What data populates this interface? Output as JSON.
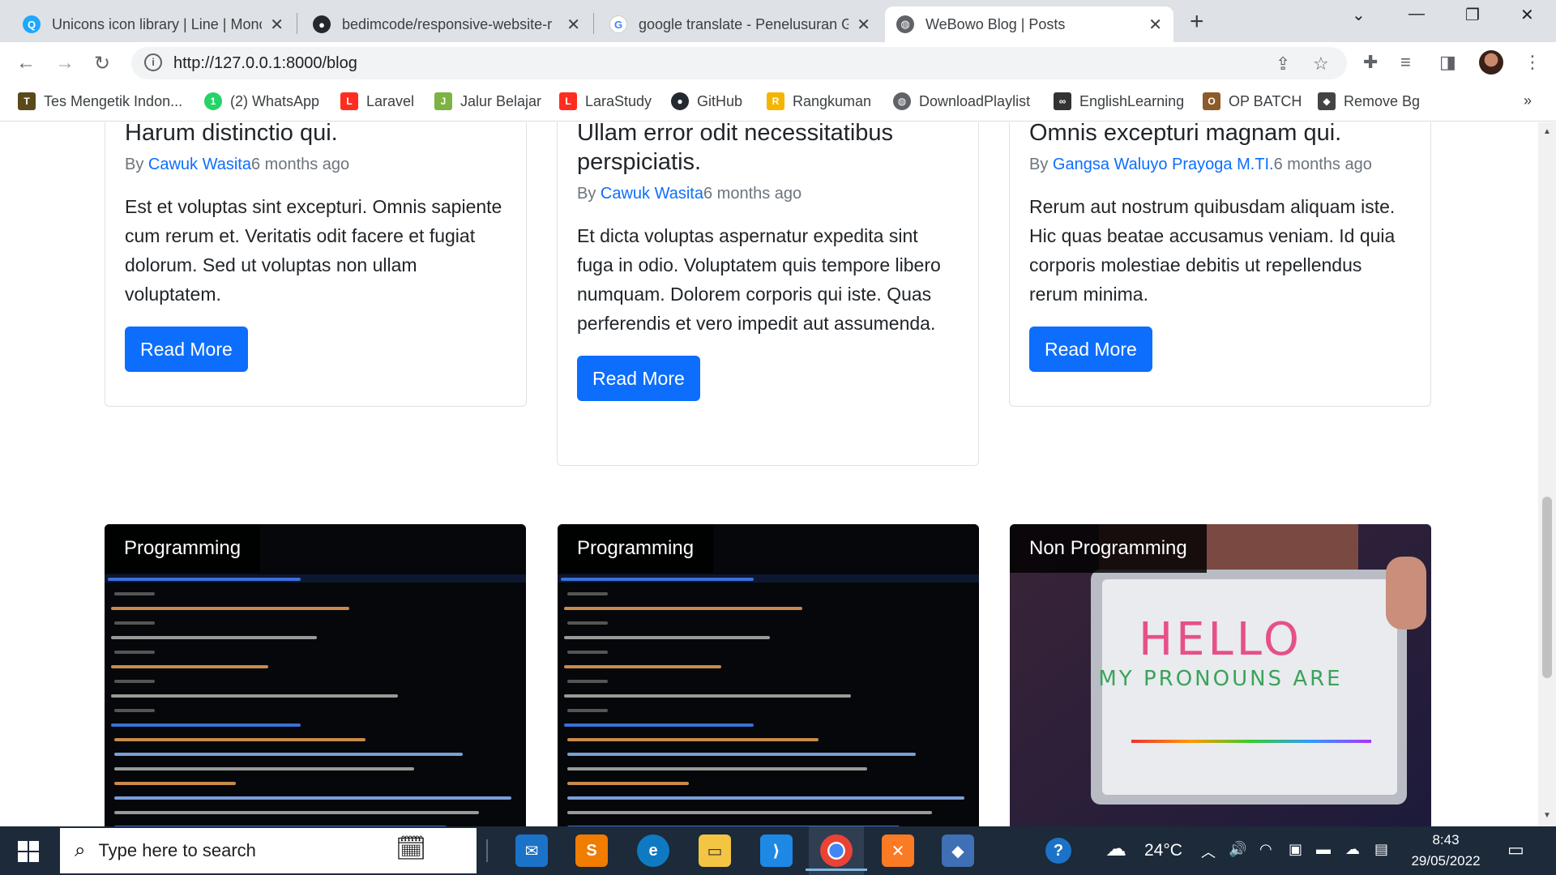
{
  "browser": {
    "tabs": [
      {
        "title": "Unicons icon library | Line | Monc",
        "close": "✕"
      },
      {
        "title": "bedimcode/responsive-website-r",
        "close": "✕"
      },
      {
        "title": "google translate - Penelusuran G",
        "close": "✕"
      },
      {
        "title": "WeBowo Blog | Posts",
        "close": "✕"
      }
    ],
    "new_tab": "+",
    "url": "http://127.0.0.1:8000/blog",
    "bookmarks": [
      "Tes Mengetik Indon...",
      "(2) WhatsApp",
      "Laravel",
      "Jalur Belajar",
      "LaraStudy",
      "GitHub",
      "Rangkuman",
      "DownloadPlaylist",
      "EnglishLearning",
      "OP BATCH",
      "Remove Bg"
    ],
    "bookmarks_more": "»"
  },
  "posts": [
    {
      "title": "Harum distinctio qui.",
      "by": "By",
      "author": "Cawuk Wasita",
      "ago": "6 months ago",
      "excerpt": "Est et voluptas sint excepturi. Omnis sapiente cum rerum et. Veritatis odit facere et fugiat dolorum. Sed ut voluptas non ullam voluptatem.",
      "button": "Read More"
    },
    {
      "title": "Ullam error odit necessitatibus perspiciatis.",
      "by": "By",
      "author": "Cawuk Wasita",
      "ago": "6 months ago",
      "excerpt": "Et dicta voluptas aspernatur expedita sint fuga in odio. Voluptatem quis tempore libero numquam. Dolorem corporis qui iste. Quas perferendis et vero impedit aut assumenda.",
      "button": "Read More"
    },
    {
      "title": "Omnis excepturi magnam qui.",
      "by": "By",
      "author": "Gangsa Waluyo Prayoga M.TI.",
      "ago": "6 months ago",
      "excerpt": "Rerum aut nostrum quibusdam aliquam iste. Hic quas beatae accusamus veniam. Id quia corporis molestiae debitis ut repellendus rerum minima.",
      "button": "Read More"
    }
  ],
  "next_posts": [
    {
      "category": "Programming"
    },
    {
      "category": "Programming"
    },
    {
      "category": "Non Programming",
      "sign_line1": "HELLO",
      "sign_line2": "MY PRONOUNS ARE"
    }
  ],
  "taskbar": {
    "search_placeholder": "Type here to search",
    "weather": "24°C",
    "time": "8:43",
    "date": "29/05/2022"
  },
  "colors": {
    "link": "#0d6efd",
    "button": "#0d6efd",
    "taskbar": "#1c2a3a"
  }
}
